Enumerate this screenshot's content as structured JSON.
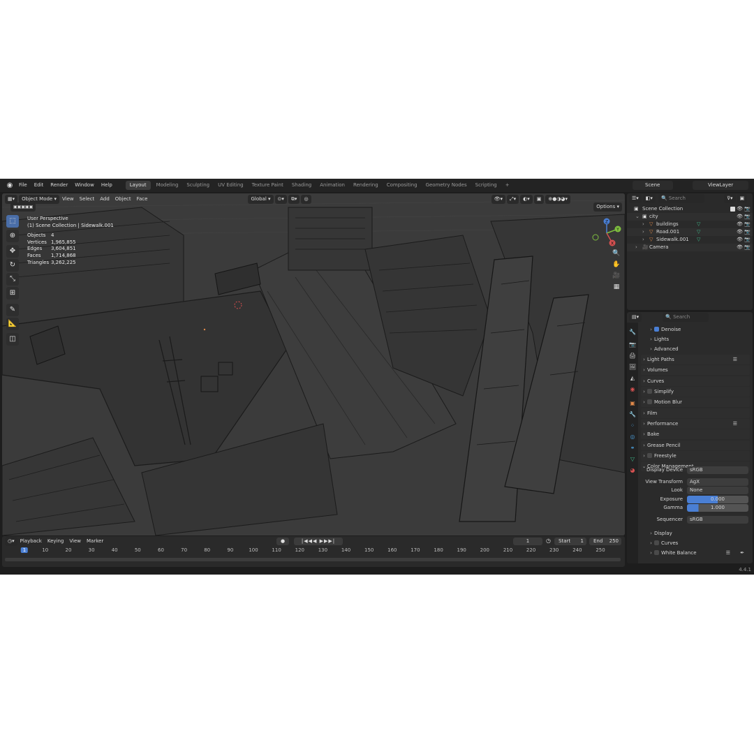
{
  "menu": {
    "file": "File",
    "edit": "Edit",
    "render": "Render",
    "window": "Window",
    "help": "Help"
  },
  "workspaces": [
    "Layout",
    "Modeling",
    "Sculpting",
    "UV Editing",
    "Texture Paint",
    "Shading",
    "Animation",
    "Rendering",
    "Compositing",
    "Geometry Nodes",
    "Scripting"
  ],
  "workspace_add": "+",
  "scene": {
    "name": "Scene",
    "view_layer": "ViewLayer"
  },
  "viewport": {
    "mode": "Object Mode",
    "menus": [
      "View",
      "Select",
      "Add",
      "Object",
      "Face"
    ],
    "orientation": "Global",
    "options": "Options",
    "perspective": "User Perspective",
    "collection_info": "(1) Scene Collection | Sidewalk.001",
    "stats": [
      {
        "label": "Objects",
        "value": "4"
      },
      {
        "label": "Vertices",
        "value": "1,965,855"
      },
      {
        "label": "Edges",
        "value": "3,604,851"
      },
      {
        "label": "Faces",
        "value": "1,714,868"
      },
      {
        "label": "Triangles",
        "value": "3,262,225"
      }
    ],
    "gizmo_axes": [
      "Z",
      "Y",
      "X"
    ]
  },
  "timeline": {
    "menus": [
      "Playback",
      "Keying",
      "View",
      "Marker"
    ],
    "current_frame": "1",
    "start_label": "Start",
    "start": "1",
    "end_label": "End",
    "end": "250",
    "ruler": [
      "1",
      "10",
      "20",
      "30",
      "40",
      "50",
      "60",
      "70",
      "80",
      "90",
      "100",
      "110",
      "120",
      "130",
      "140",
      "150",
      "160",
      "170",
      "180",
      "190",
      "200",
      "210",
      "220",
      "230",
      "240",
      "250"
    ]
  },
  "outliner": {
    "search_placeholder": "Search",
    "root": "Scene Collection",
    "items": [
      {
        "name": "city",
        "depth": 1
      },
      {
        "name": "buildings",
        "depth": 2
      },
      {
        "name": "Road.001",
        "depth": 2
      },
      {
        "name": "Sidewalk.001",
        "depth": 2
      },
      {
        "name": "Camera",
        "depth": 1
      }
    ]
  },
  "properties": {
    "search_placeholder": "Search",
    "sections": [
      {
        "label": "Denoise",
        "checkbox": true,
        "checked": true,
        "sub": true
      },
      {
        "label": "Lights",
        "sub": true
      },
      {
        "label": "Advanced",
        "sub": true
      },
      {
        "label": "Light Paths"
      },
      {
        "label": "Volumes"
      },
      {
        "label": "Curves"
      },
      {
        "label": "Simplify",
        "checkbox": true
      },
      {
        "label": "Motion Blur",
        "checkbox": true
      },
      {
        "label": "Film"
      },
      {
        "label": "Performance"
      },
      {
        "label": "Bake"
      },
      {
        "label": "Grease Pencil"
      },
      {
        "label": "Freestyle",
        "checkbox": true
      },
      {
        "label": "Color Management",
        "open": true
      }
    ],
    "color_management": {
      "display_device_label": "Display Device",
      "display_device": "sRGB",
      "view_transform_label": "View Transform",
      "view_transform": "AgX",
      "look_label": "Look",
      "look": "None",
      "exposure_label": "Exposure",
      "exposure": "0.000",
      "gamma_label": "Gamma",
      "gamma": "1.000",
      "sequencer_label": "Sequencer",
      "sequencer": "sRGB"
    },
    "subsections": [
      {
        "label": "Display"
      },
      {
        "label": "Curves",
        "checkbox": true
      },
      {
        "label": "White Balance",
        "checkbox": true
      }
    ]
  },
  "version": "4.4.1",
  "colors": {
    "accent": "#4a7fd4",
    "object_orange": "#e0894a",
    "mesh_green": "#3fbf8f"
  }
}
